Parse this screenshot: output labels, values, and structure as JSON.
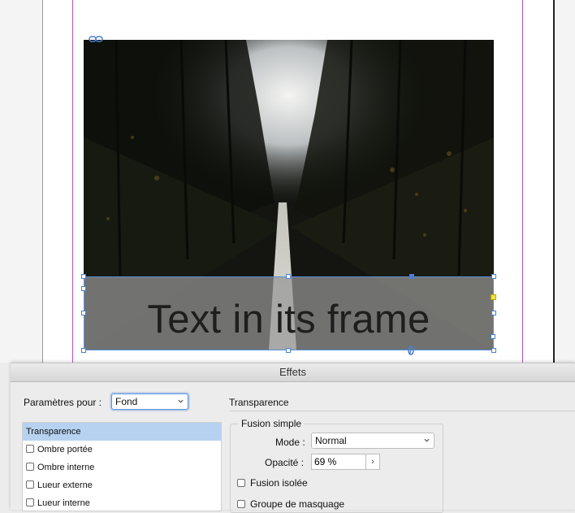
{
  "document": {
    "text_frame_text": "Text in its frame"
  },
  "dialog": {
    "title": "Effets",
    "settings_for_label": "Paramètres pour :",
    "settings_for_value": "Fond",
    "effects": [
      {
        "label": "Transparence",
        "selected": true,
        "has_checkbox": false
      },
      {
        "label": "Ombre portée",
        "selected": false,
        "has_checkbox": true,
        "checked": false
      },
      {
        "label": "Ombre interne",
        "selected": false,
        "has_checkbox": true,
        "checked": false
      },
      {
        "label": "Lueur externe",
        "selected": false,
        "has_checkbox": true,
        "checked": false
      },
      {
        "label": "Lueur interne",
        "selected": false,
        "has_checkbox": true,
        "checked": false
      }
    ],
    "section_title": "Transparence",
    "group_title": "Fusion simple",
    "mode_label": "Mode :",
    "mode_value": "Normal",
    "opacity_label": "Opacité :",
    "opacity_value": "69 %",
    "opacity_stepper": "›",
    "isolated_blend_label": "Fusion isolée",
    "isolated_blend_checked": false,
    "knockout_group_label": "Groupe de masquage",
    "knockout_group_checked": false
  }
}
